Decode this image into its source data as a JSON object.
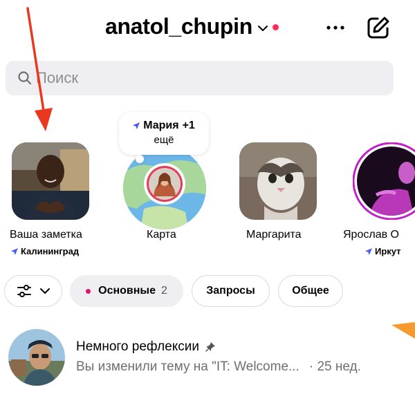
{
  "header": {
    "username": "anatol_chupin",
    "more_icon": "more-horizontal-icon",
    "compose_icon": "compose-icon"
  },
  "search": {
    "placeholder": "Поиск"
  },
  "bubble": {
    "name": "Мария",
    "plus": "+1",
    "more": "ещё"
  },
  "notes": [
    {
      "label": "Ваша заметка",
      "location": "Калининград"
    },
    {
      "label": "Карта",
      "location": ""
    },
    {
      "label": "Маргарита",
      "location": ""
    },
    {
      "label": "Ярослав О",
      "location": "Иркут"
    }
  ],
  "chips": {
    "primary": {
      "label": "Основные",
      "count": "2"
    },
    "requests": {
      "label": "Запросы"
    },
    "general": {
      "label": "Общее"
    }
  },
  "thread": {
    "title": "Немного рефлексии",
    "subtitle": "Вы изменили тему на \"IT: Welcome...",
    "time": "· 25 нед."
  },
  "colors": {
    "accent_red": "#ff2d55",
    "pink_dot": "#e5106a",
    "location_arrow": "#4b5cf0",
    "search_bg": "#efeff2",
    "annotation_arrow": "#e8391e"
  }
}
